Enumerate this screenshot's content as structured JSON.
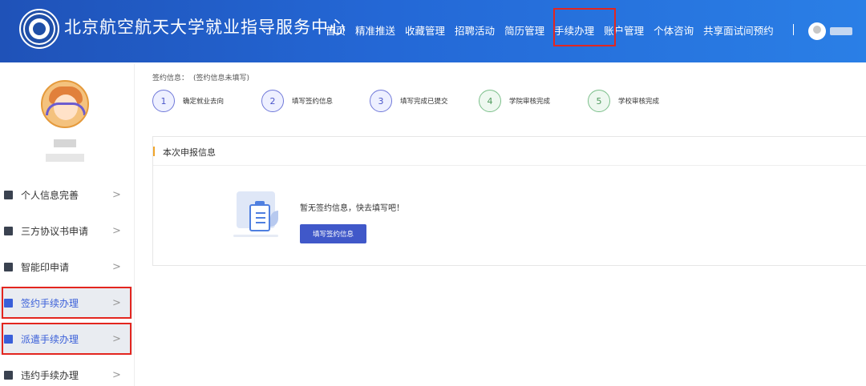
{
  "header": {
    "site_title": "北京航空航天大学就业指导服务中心",
    "nav": [
      {
        "label": "首页"
      },
      {
        "label": "精准推送"
      },
      {
        "label": "收藏管理"
      },
      {
        "label": "招聘活动"
      },
      {
        "label": "简历管理"
      },
      {
        "label": "手续办理",
        "active": true
      },
      {
        "label": "账户管理"
      },
      {
        "label": "个体咨询"
      },
      {
        "label": "共享面试间预约"
      }
    ],
    "user_icon": "user-avatar-icon"
  },
  "sidebar": {
    "menu": [
      {
        "label": "个人信息完善",
        "icon": "user-icon"
      },
      {
        "label": "三方协议书申请",
        "icon": "document-icon"
      },
      {
        "label": "智能印申请",
        "icon": "stamp-icon"
      },
      {
        "label": "签约手续办理",
        "icon": "building-icon",
        "selected": true
      },
      {
        "label": "派遣手续办理",
        "icon": "badge-icon",
        "selected": true
      },
      {
        "label": "违约手续办理",
        "icon": "document-icon"
      }
    ]
  },
  "main": {
    "sign_info_label": "签约信息：",
    "sign_info_note": "(签约信息未填写)",
    "steps": [
      {
        "num": "1",
        "label": "确定就业去向"
      },
      {
        "num": "2",
        "label": "填写签约信息"
      },
      {
        "num": "3",
        "label": "填写完成已提交"
      },
      {
        "num": "4",
        "label": "学院审核完成"
      },
      {
        "num": "5",
        "label": "学校审核完成"
      }
    ],
    "panel_title": "本次申报信息",
    "empty_text": "暂无签约信息，快去填写吧！",
    "fill_button": "填写签约信息"
  },
  "colors": {
    "header_gradient_start": "#1f52b8",
    "header_gradient_end": "#2a7fe6",
    "accent_blue": "#4058c9",
    "highlight_red": "#e3261f",
    "step_green": "#7bbf8a",
    "step_purple": "#6f78d9"
  }
}
